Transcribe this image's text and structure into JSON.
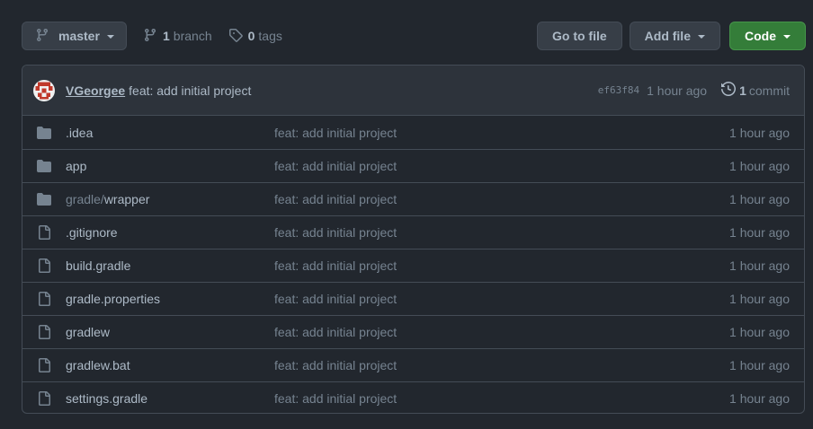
{
  "toolbar": {
    "branch_name": "master",
    "branch_count": "1",
    "branch_label": "branch",
    "tag_count": "0",
    "tag_label": "tags",
    "goto_label": "Go to file",
    "add_file_label": "Add file",
    "code_label": "Code"
  },
  "commit": {
    "author": "VGeorgee",
    "message": "feat: add initial project",
    "sha": "ef63f84",
    "when": "1 hour ago",
    "count": "1",
    "count_label": "commit"
  },
  "files": [
    {
      "prefix": "",
      "name": ".idea",
      "type": "folder",
      "message": "feat: add initial project",
      "age": "1 hour ago"
    },
    {
      "prefix": "",
      "name": "app",
      "type": "folder",
      "message": "feat: add initial project",
      "age": "1 hour ago"
    },
    {
      "prefix": "gradle/",
      "name": "wrapper",
      "type": "folder",
      "message": "feat: add initial project",
      "age": "1 hour ago"
    },
    {
      "prefix": "",
      "name": ".gitignore",
      "type": "file",
      "message": "feat: add initial project",
      "age": "1 hour ago"
    },
    {
      "prefix": "",
      "name": "build.gradle",
      "type": "file",
      "message": "feat: add initial project",
      "age": "1 hour ago"
    },
    {
      "prefix": "",
      "name": "gradle.properties",
      "type": "file",
      "message": "feat: add initial project",
      "age": "1 hour ago"
    },
    {
      "prefix": "",
      "name": "gradlew",
      "type": "file",
      "message": "feat: add initial project",
      "age": "1 hour ago"
    },
    {
      "prefix": "",
      "name": "gradlew.bat",
      "type": "file",
      "message": "feat: add initial project",
      "age": "1 hour ago"
    },
    {
      "prefix": "",
      "name": "settings.gradle",
      "type": "file",
      "message": "feat: add initial project",
      "age": "1 hour ago"
    }
  ],
  "colors": {
    "background": "#22272e",
    "code_button": "#347d39",
    "folder_icon": "#768390"
  }
}
